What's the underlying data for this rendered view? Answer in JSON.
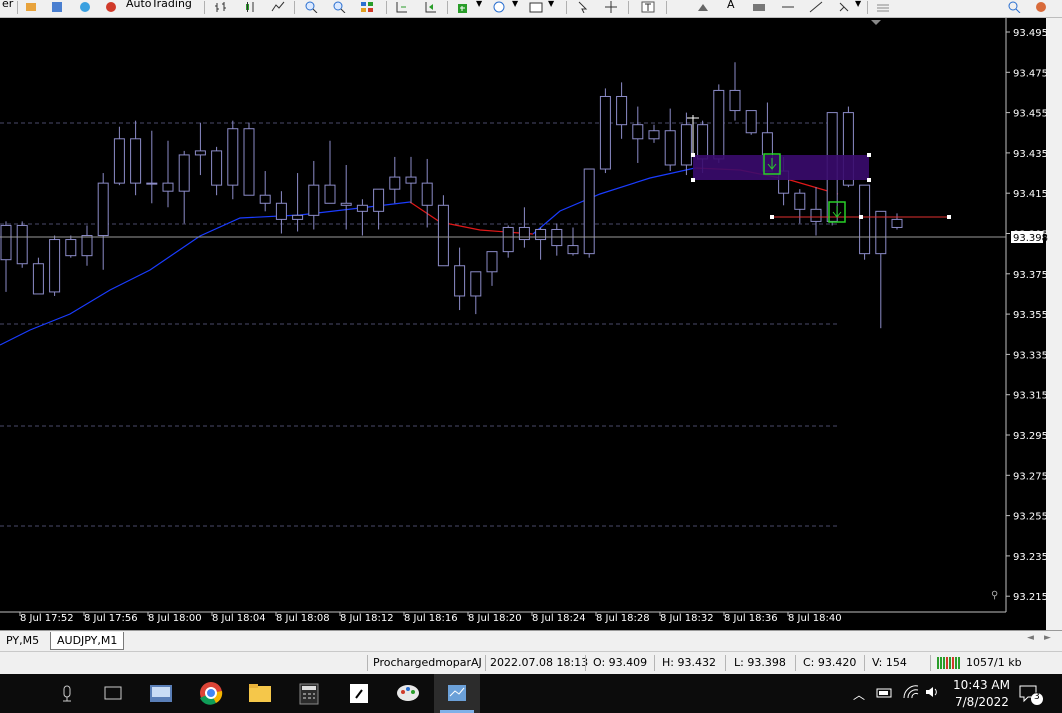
{
  "toolbar": {
    "partial_left_label": "er",
    "autotrading_label": "AutoTrading"
  },
  "chart": {
    "symbol_tab_active": "AUDJPY,M1",
    "symbol_tab_prev": "PY,M5",
    "price_axis": [
      "93.495",
      "93.475",
      "93.455",
      "93.435",
      "93.415",
      "93.395",
      "93.375",
      "93.355",
      "93.335",
      "93.315",
      "93.295",
      "93.275",
      "93.255",
      "93.235",
      "93.215"
    ],
    "current_price_label": "93.398",
    "time_axis": [
      "8 Jul 17:52",
      "8 Jul 17:56",
      "8 Jul 18:00",
      "8 Jul 18:04",
      "8 Jul 18:08",
      "8 Jul 18:12",
      "8 Jul 18:16",
      "8 Jul 18:20",
      "8 Jul 18:24",
      "8 Jul 18:28",
      "8 Jul 18:32",
      "8 Jul 18:36",
      "8 Jul 18:40"
    ],
    "colors": {
      "background": "#000000",
      "candle_border": "#8c8cc8",
      "bull_body": "#000000",
      "bear_body": "#000000",
      "ma_blue": "#1a3cff",
      "ma_red": "#e01818",
      "zone": "#3a0b6e",
      "grid": "#4a4a6a"
    }
  },
  "status": {
    "profile": "ProchargedmoparAJ",
    "datetime": "2022.07.08 18:13",
    "open": "O: 93.409",
    "high": "H: 93.432",
    "low": "L: 93.398",
    "close": "C: 93.420",
    "volume": "V: 154",
    "traffic": "1057/1 kb"
  },
  "taskbar": {
    "time": "10:43 AM",
    "date": "7/8/2022",
    "notification_count": "3",
    "apps": [
      "microphone-icon",
      "task-view-icon",
      "app-icon-1",
      "chrome-icon",
      "file-explorer-icon",
      "calculator-icon",
      "sticky-notes-icon",
      "paint-icon",
      "metatrader-icon"
    ]
  }
}
